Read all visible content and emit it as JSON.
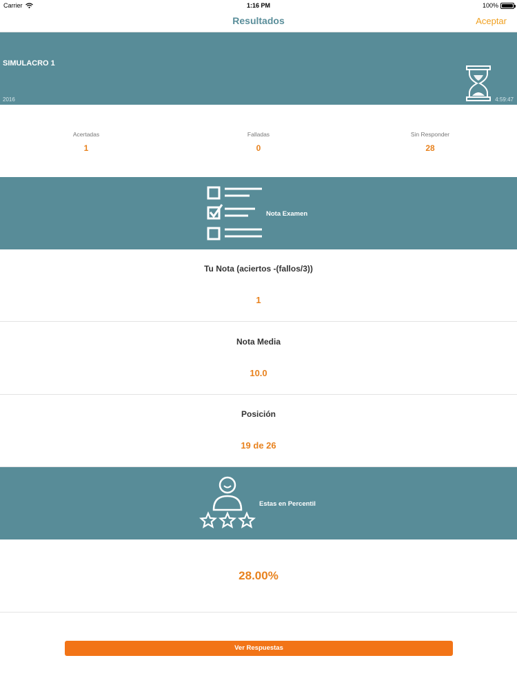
{
  "status": {
    "carrier": "Carrier",
    "time": "1:16 PM",
    "battery": "100%"
  },
  "nav": {
    "title": "Resultados",
    "accept": "Aceptar"
  },
  "exam": {
    "title": "SIMULACRO 1",
    "year": "2016",
    "time": "4:59:47"
  },
  "stats": [
    {
      "label": "Acertadas",
      "value": "1"
    },
    {
      "label": "Falladas",
      "value": "0"
    },
    {
      "label": "Sin Responder",
      "value": "28"
    }
  ],
  "grade_section": {
    "label": "Nota Examen"
  },
  "grade_rows": [
    {
      "label": "Tu Nota (aciertos -(fallos/3))",
      "value": "1"
    },
    {
      "label": "Nota Media",
      "value": "10.0"
    },
    {
      "label": "Posición",
      "value": "19 de 26"
    }
  ],
  "percentile_section": {
    "label": "Estas en Percentil",
    "value": "28.00%"
  },
  "actions": {
    "view_answers": "Ver Respuestas"
  },
  "colors": {
    "teal": "#588c98",
    "accent_orange": "#e8821e",
    "button_orange": "#f27417"
  },
  "icons": {
    "hourglass": "hourglass-icon",
    "checklist": "checklist-icon",
    "person_stars": "person-stars-icon",
    "wifi": "wifi-icon",
    "battery": "battery-icon"
  }
}
